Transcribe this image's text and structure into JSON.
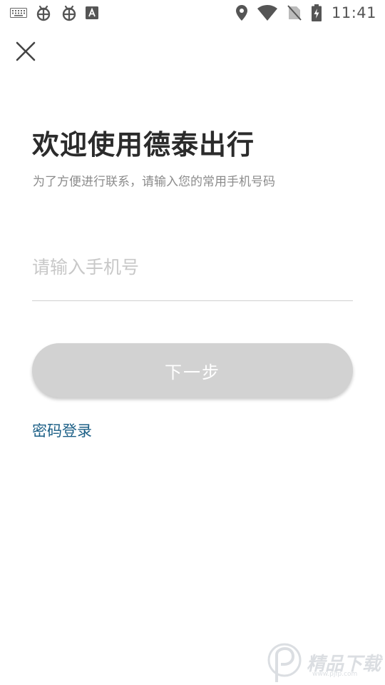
{
  "status_bar": {
    "time": "11:41",
    "left_icons": [
      "keyboard-icon",
      "bug-icon",
      "bug-icon",
      "font-a-icon"
    ],
    "right_icons": [
      "location-icon",
      "wifi-icon",
      "no-sim-icon",
      "battery-charging-icon"
    ]
  },
  "header": {
    "close_icon": "close-icon"
  },
  "main": {
    "title": "欢迎使用德泰出行",
    "subtitle": "为了方便进行联系，请输入您的常用手机号码",
    "phone_placeholder": "请输入手机号",
    "phone_value": "",
    "next_button_label": "下一步",
    "password_login_label": "密码登录"
  },
  "watermark": {
    "text": "精品下载",
    "url": "www.pjfp.com"
  },
  "colors": {
    "title": "#2b2b2b",
    "subtitle": "#8c8c8c",
    "placeholder": "#c8c8c8",
    "button_disabled": "#d2d2d2",
    "link": "#1b5f86"
  }
}
